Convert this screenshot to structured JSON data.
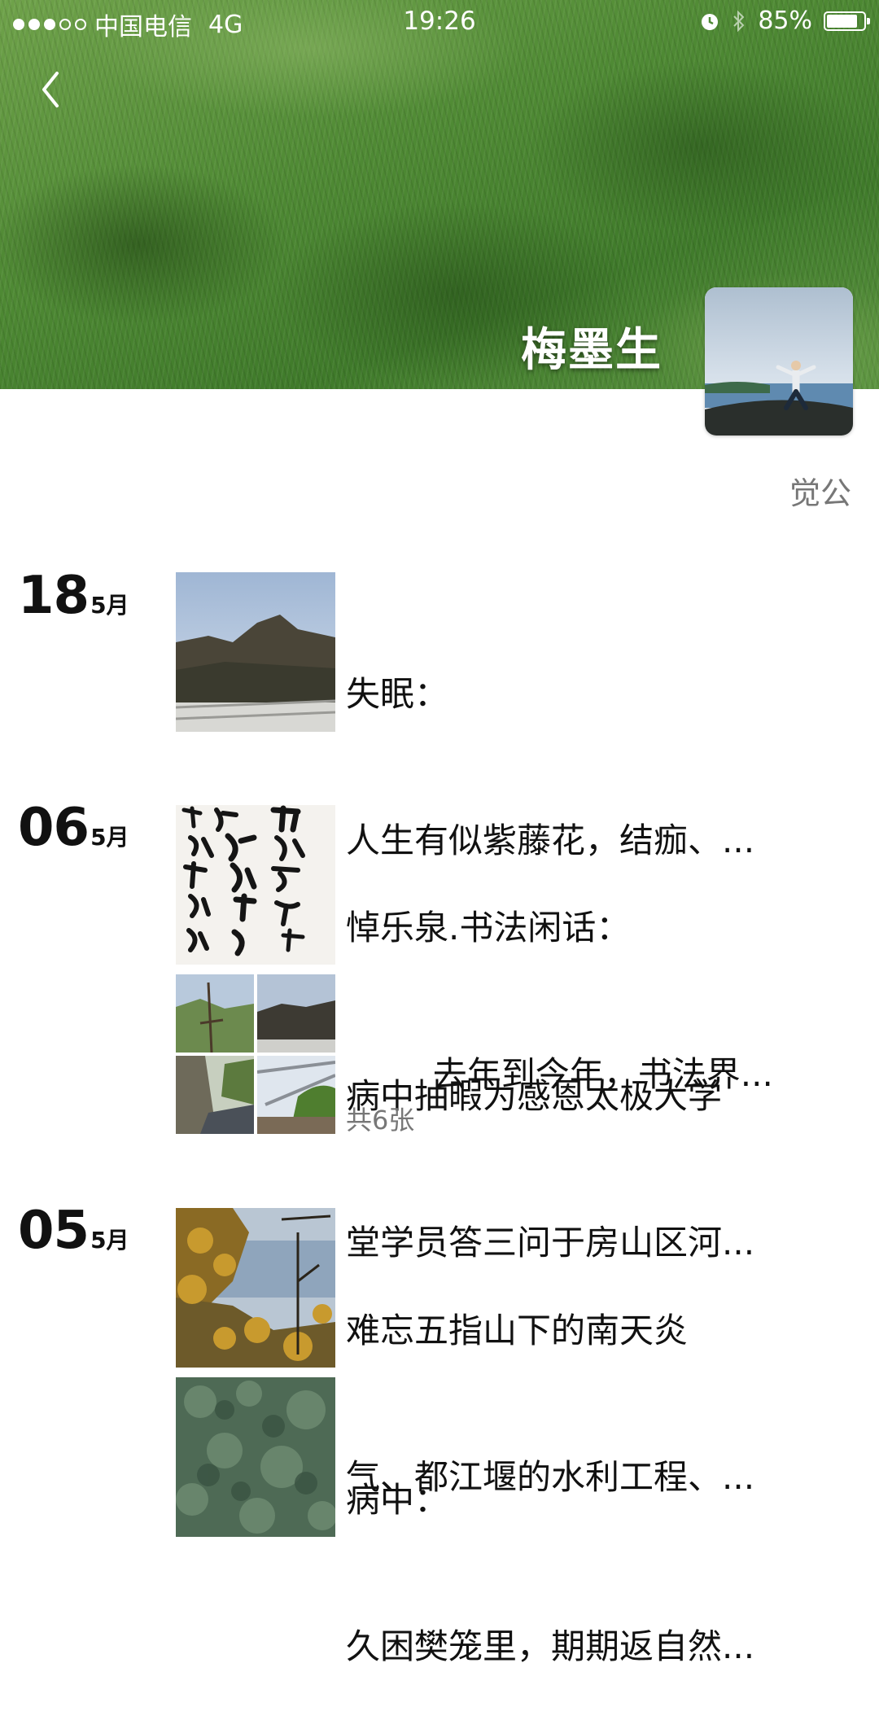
{
  "status_bar": {
    "carrier": "中国电信",
    "network": "4G",
    "time": "19:26",
    "battery": "85%",
    "battery_level": 0.85
  },
  "profile": {
    "name": "梅墨生",
    "signature": "觉公"
  },
  "timeline": {
    "day1": {
      "day": "18",
      "month": "5月"
    },
    "day2": {
      "day": "06",
      "month": "5月"
    },
    "day3": {
      "day": "05",
      "month": "5月"
    }
  },
  "posts": {
    "p1": {
      "line1": "失眠：",
      "line2": "人生有似紫藤花，结痂、..."
    },
    "p2": {
      "line1": "悼乐泉.书法闲话：",
      "line2": "        去年到今年，书法界..."
    },
    "p3": {
      "line1": "病中抽暇为感恩太极大学",
      "line2": "堂学员答三问于房山区河...",
      "count": "共6张"
    },
    "p4": {
      "line1": "难忘五指山下的南天炎",
      "line2": "气、都江堰的水利工程、..."
    },
    "p5": {
      "line1": "病中：",
      "line2": "久困樊笼里，期期返自然..."
    }
  },
  "icons": {
    "back": "chevron-left-icon",
    "alarm": "alarm-icon",
    "bluetooth": "bluetooth-icon",
    "battery": "battery-icon"
  }
}
